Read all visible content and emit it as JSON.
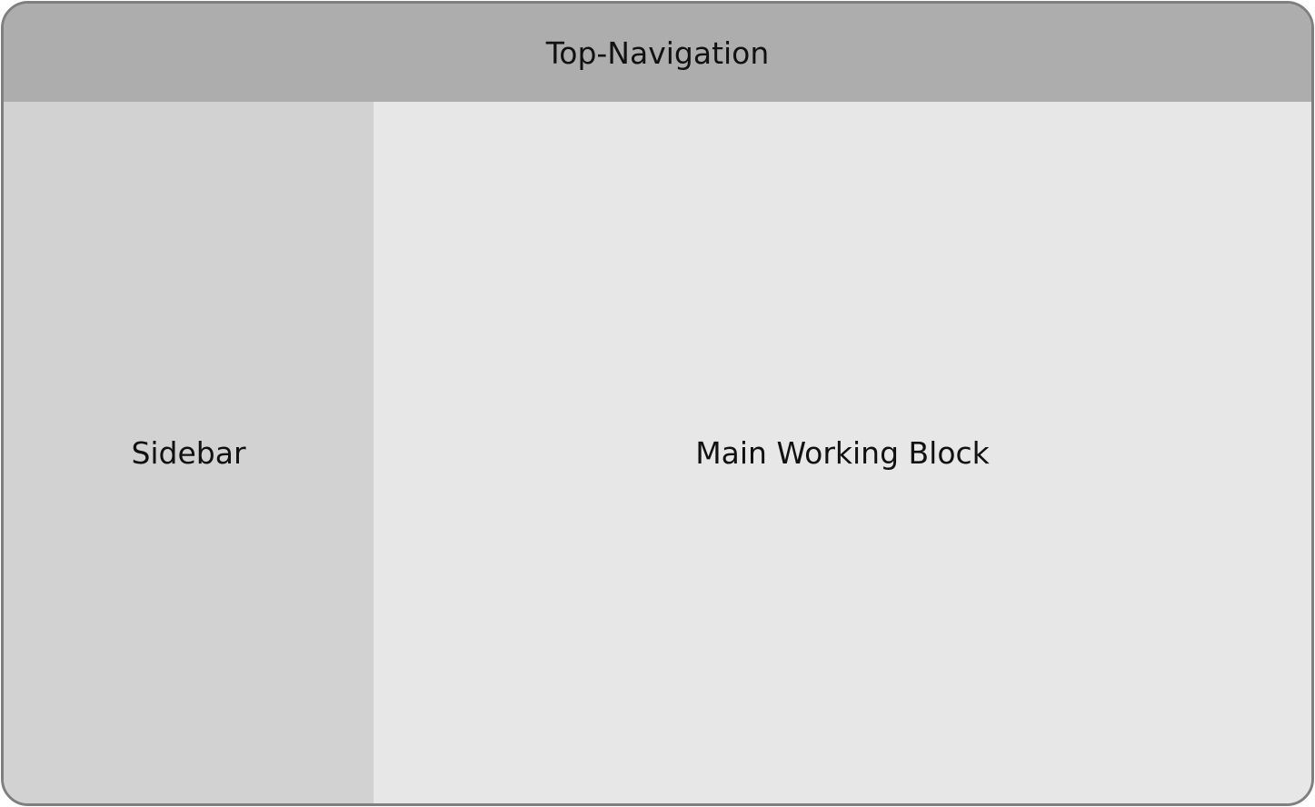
{
  "top_navigation": {
    "label": "Top-Navigation"
  },
  "sidebar": {
    "label": "Sidebar"
  },
  "main_working_block": {
    "label": "Main Working Block"
  },
  "colors": {
    "frame_border": "#7f7f7f",
    "top_navigation_bg": "#adadad",
    "sidebar_bg": "#d2d2d2",
    "main_working_block_bg": "#e7e7e7",
    "text": "#111111"
  }
}
